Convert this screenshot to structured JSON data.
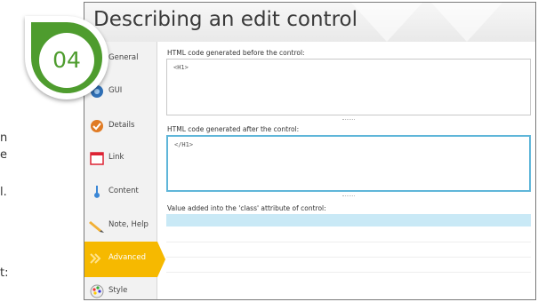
{
  "page_fragments": [
    "n",
    "e",
    "l.",
    "t:"
  ],
  "window": {
    "title": "Describing an edit control"
  },
  "step_badge": "04",
  "sidebar": {
    "items": [
      {
        "label": "General",
        "icon": "general-icon"
      },
      {
        "label": "GUI",
        "icon": "gui-icon"
      },
      {
        "label": "Details",
        "icon": "details-icon"
      },
      {
        "label": "Link",
        "icon": "link-icon"
      },
      {
        "label": "Content",
        "icon": "content-icon"
      },
      {
        "label": "Note, Help",
        "icon": "note-help-icon"
      },
      {
        "label": "Advanced",
        "icon": "advanced-icon",
        "active": true
      },
      {
        "label": "Style",
        "icon": "style-icon"
      }
    ],
    "active_color": "#f6b900"
  },
  "fields": {
    "before": {
      "label": "HTML code generated before the control:",
      "value": "<H1>"
    },
    "after": {
      "label": "HTML code generated after the control:",
      "value": "</H1>"
    },
    "class_attr": {
      "label": "Value added into the 'class' attribute of control:",
      "value": ""
    }
  },
  "colors": {
    "badge_green": "#4e9c2e",
    "focus_blue": "#5fb6d9",
    "class_row_highlight": "#c9e9f6"
  }
}
